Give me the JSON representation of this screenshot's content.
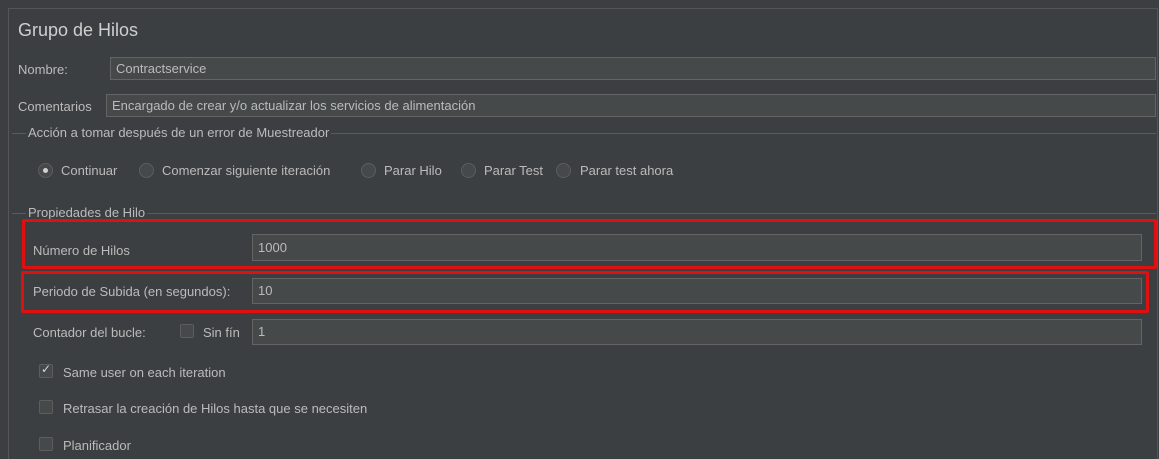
{
  "panel": {
    "title": "Grupo de Hilos"
  },
  "name_row": {
    "label": "Nombre:",
    "value": "Contractservice"
  },
  "comments_row": {
    "label": "Comentarios",
    "value": "Encargado de crear y/o actualizar los servicios de alimentación"
  },
  "error_action": {
    "group_title": "Acción a tomar después de un error de Muestreador",
    "options": [
      {
        "label": "Continuar",
        "checked": true
      },
      {
        "label": "Comenzar siguiente iteración",
        "checked": false
      },
      {
        "label": "Parar Hilo",
        "checked": false
      },
      {
        "label": "Parar Test",
        "checked": false
      },
      {
        "label": "Parar test ahora",
        "checked": false
      }
    ]
  },
  "thread_props": {
    "group_title": "Propiedades de Hilo",
    "num_threads": {
      "label": "Número de Hilos",
      "value": "1000"
    },
    "ramp_up": {
      "label": "Periodo de Subida (en segundos):",
      "value": "10"
    },
    "loop": {
      "label": "Contador del bucle:",
      "forever_label": "Sin fín",
      "forever_checked": false,
      "value": "1"
    },
    "same_user": {
      "label": "Same user on each iteration",
      "checked": true
    },
    "delay_creation": {
      "label": "Retrasar la creación de Hilos hasta que se necesiten",
      "checked": false
    },
    "scheduler": {
      "label": "Planificador",
      "checked": false
    }
  },
  "colors": {
    "background": "#3c3f41",
    "field": "#45494a",
    "highlight": "#e01010"
  }
}
